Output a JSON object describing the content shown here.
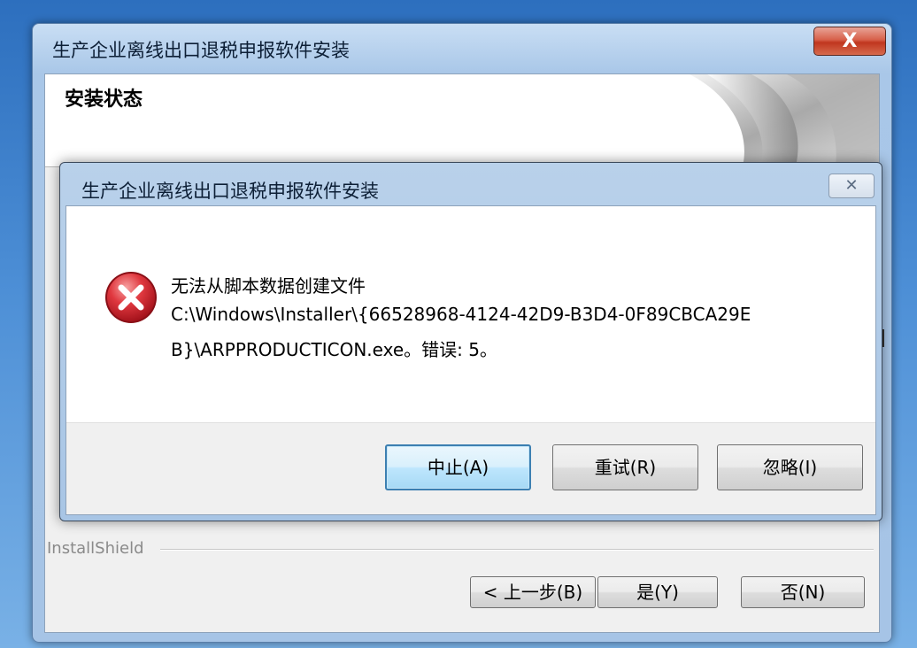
{
  "outer_window": {
    "title": "生产企业离线出口退税申报软件安装",
    "close_label": "X",
    "header_title": "安装状态",
    "installshield_label": "InstallShield",
    "buttons": {
      "back_label": "< 上一步(B)",
      "yes_label": "是(Y)",
      "no_label": "否(N)"
    }
  },
  "error_dialog": {
    "title": "生产企业离线出口退税申报软件安装",
    "close_label": "✕",
    "icon": "error-icon",
    "message_lines": [
      "无法从脚本数据创建文件",
      "C:\\Windows\\Installer\\{66528968-4124-42D9-B3D4-0F89CBCA29E",
      "B}\\ARPPRODUCTICON.exe。错误: 5。"
    ],
    "buttons": {
      "abort_label": "中止(A)",
      "retry_label": "重试(R)",
      "ignore_label": "忽略(I)"
    }
  },
  "colors": {
    "desktop": "#4d8fd6",
    "title_bar": "#a9c7e8",
    "close_red": "#c0361f",
    "error_red": "#c8202a",
    "default_button_border": "#3c7fb1"
  }
}
